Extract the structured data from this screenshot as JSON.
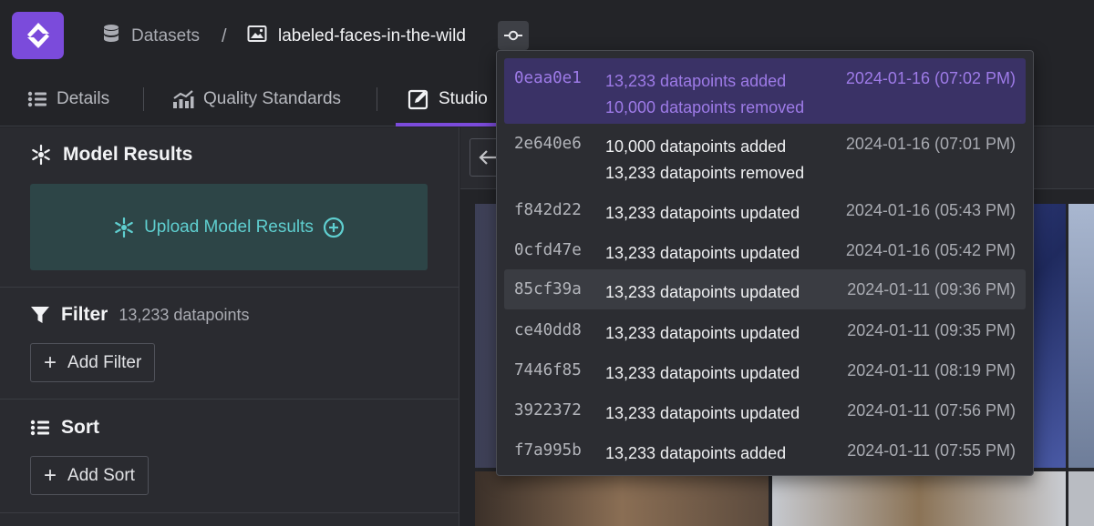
{
  "breadcrumb": {
    "datasets_label": "Datasets",
    "separator": "/",
    "dataset_name": "labeled-faces-in-the-wild"
  },
  "tabs": [
    {
      "label": "Details",
      "icon": "list-icon"
    },
    {
      "label": "Quality Standards",
      "icon": "chart-icon"
    },
    {
      "label": "Studio",
      "icon": "edit-icon",
      "active": true
    }
  ],
  "sidebar": {
    "model_results": {
      "title": "Model Results",
      "upload_label": "Upload Model Results"
    },
    "filter": {
      "title": "Filter",
      "count": "13,233 datapoints",
      "button_label": "Add Filter"
    },
    "sort": {
      "title": "Sort",
      "button_label": "Add Sort"
    }
  },
  "commits": [
    {
      "hash": "0eaa0e1",
      "lines": [
        "13,233 datapoints added",
        "10,000 datapoints removed"
      ],
      "date": "2024-01-16 (07:02 PM)",
      "selected": true
    },
    {
      "hash": "2e640e6",
      "lines": [
        "10,000 datapoints added",
        "13,233 datapoints removed"
      ],
      "date": "2024-01-16 (07:01 PM)"
    },
    {
      "hash": "f842d22",
      "lines": [
        "13,233 datapoints updated"
      ],
      "date": "2024-01-16 (05:43 PM)"
    },
    {
      "hash": "0cfd47e",
      "lines": [
        "13,233 datapoints updated"
      ],
      "date": "2024-01-16 (05:42 PM)"
    },
    {
      "hash": "85cf39a",
      "lines": [
        "13,233 datapoints updated"
      ],
      "date": "2024-01-11 (09:36 PM)",
      "hover": true
    },
    {
      "hash": "ce40dd8",
      "lines": [
        "13,233 datapoints updated"
      ],
      "date": "2024-01-11 (09:35 PM)"
    },
    {
      "hash": "7446f85",
      "lines": [
        "13,233 datapoints updated"
      ],
      "date": "2024-01-11 (08:19 PM)"
    },
    {
      "hash": "3922372",
      "lines": [
        "13,233 datapoints updated"
      ],
      "date": "2024-01-11 (07:56 PM)"
    },
    {
      "hash": "f7a995b",
      "lines": [
        "13,233 datapoints added"
      ],
      "date": "2024-01-11 (07:55 PM)"
    }
  ],
  "colors": {
    "accent": "#7b4bdb",
    "selected_text": "#9e7be8",
    "upload_text": "#5fcfd0"
  }
}
